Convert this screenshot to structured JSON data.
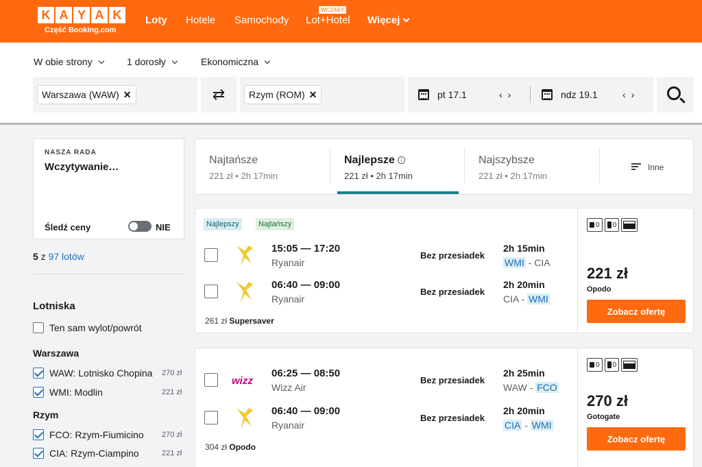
{
  "header": {
    "logo_letters": [
      "K",
      "A",
      "Y",
      "A",
      "K"
    ],
    "logo_sub": "Część Booking.com",
    "nav": {
      "flights": "Loty",
      "hotels": "Hotele",
      "cars": "Samochody",
      "packages": "Lot+Hotel",
      "packages_badge": "WCZASY",
      "more": "Więcej"
    },
    "brand_color": "#ff690f"
  },
  "search": {
    "trip_type": "W obie strony",
    "travelers": "1 dorosły",
    "cabin": "Ekonomiczna",
    "origin": "Warszawa (WAW)",
    "destination": "Rzym (ROM)",
    "depart_date": "pt 17.1",
    "return_date": "ndz 19.1"
  },
  "sidebar": {
    "advice_label": "NASZA RADA",
    "advice_title": "Wczytywanie…",
    "track_prices": "Śledź ceny",
    "track_toggle": "NIE",
    "count_shown": "5",
    "count_of": "z",
    "count_link": "97 lotów",
    "airports_title": "Lotniska",
    "same_airport": "Ten sam wylot/powrót",
    "group1": {
      "name": "Warszawa",
      "items": [
        {
          "label": "WAW: Lotnisko Chopina",
          "price": "270 zł",
          "checked": true
        },
        {
          "label": "WMI: Modlin",
          "price": "221 zł",
          "checked": true
        }
      ]
    },
    "group2": {
      "name": "Rzym",
      "items": [
        {
          "label": "FCO: Rzym-Fiumicino",
          "price": "270 zł",
          "checked": true
        },
        {
          "label": "CIA: Rzym-Ciampino",
          "price": "221 zł",
          "checked": true
        }
      ]
    }
  },
  "tabs": {
    "cheapest": {
      "title": "Najtańsze",
      "sub": "221 zł • 2h 17min"
    },
    "best": {
      "title": "Najlepsze",
      "sub": "221 zł • 2h 17min"
    },
    "fastest": {
      "title": "Najszybsze",
      "sub": "221 zł • 2h 17min"
    },
    "other": "Inne",
    "info_glyph": "i"
  },
  "results": [
    {
      "tags": [
        "Najlepszy",
        "Najtańszy"
      ],
      "legs": [
        {
          "time": "15:05 — 17:20",
          "airline": "Ryanair",
          "stops": "Bez przesiadek",
          "duration": "2h 15min",
          "from": "WMI",
          "sep": " - ",
          "to": "CIA"
        },
        {
          "time": "06:40 — 09:00",
          "airline": "Ryanair",
          "stops": "Bez przesiadek",
          "duration": "2h 20min",
          "from": "CIA",
          "sep": " - ",
          "to": "WMI"
        }
      ],
      "alt_price": "261 zł",
      "alt_provider": "Supersaver",
      "bags": {
        "carry": "0",
        "checked": "0"
      },
      "price": "221 zł",
      "provider": "Opodo",
      "cta": "Zobacz ofertę"
    },
    {
      "legs": [
        {
          "time": "06:25 — 08:50",
          "airline": "Wizz Air",
          "stops": "Bez przesiadek",
          "duration": "2h 25min",
          "from": "WAW",
          "sep": " - ",
          "to": "FCO"
        },
        {
          "time": "06:40 — 09:00",
          "airline": "Ryanair",
          "stops": "Bez przesiadek",
          "duration": "2h 20min",
          "from": "CIA",
          "sep": " - ",
          "to": "WMI"
        }
      ],
      "alt_price": "304 zł",
      "alt_provider": "Opodo",
      "bags": {
        "carry": "0",
        "checked": "0"
      },
      "price": "270 zł",
      "provider": "Gotogate",
      "cta": "Zobacz ofertę"
    }
  ]
}
